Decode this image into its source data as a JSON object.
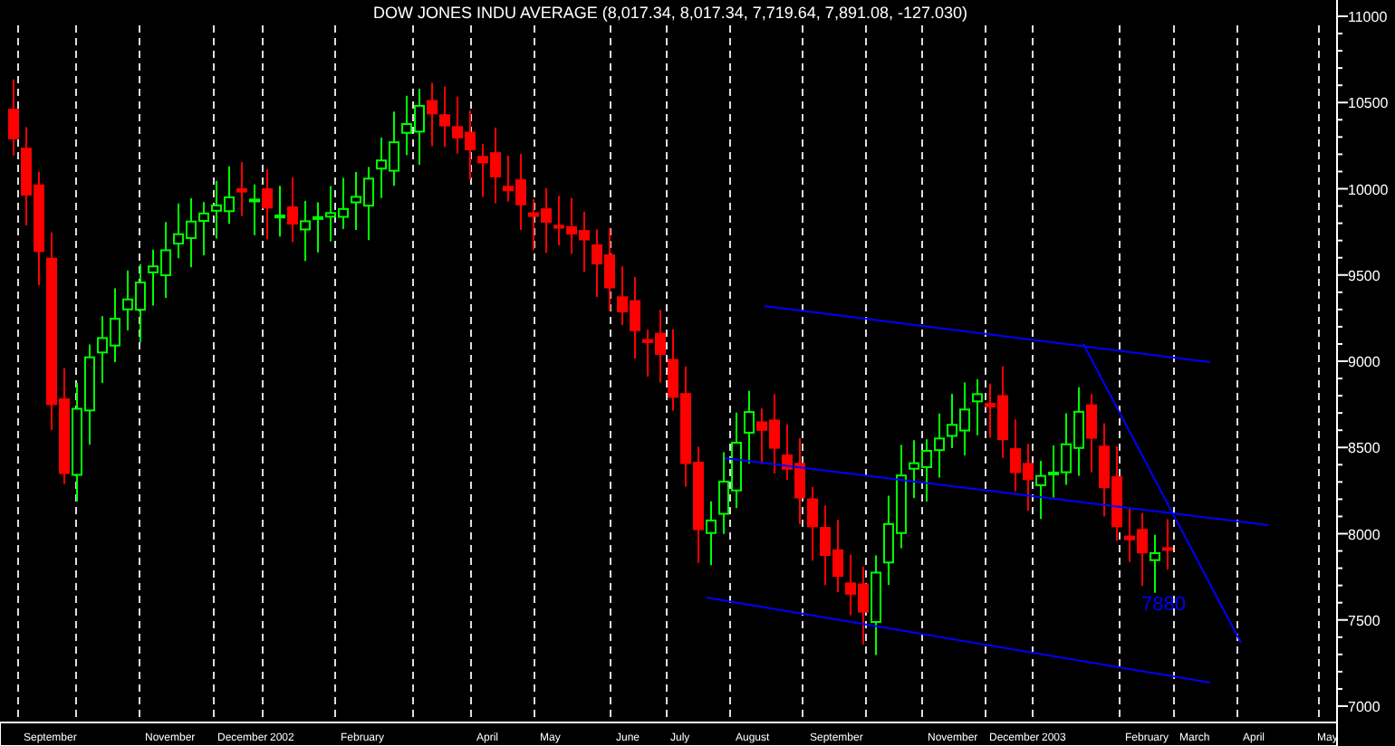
{
  "chart": {
    "title": "DOW JONES INDU AVERAGE (8,017.34, 8,017.34, 7,719.64, 7,891.08, -127.030)",
    "y_axis": [
      "11000",
      "10500",
      "10000",
      "9500",
      "9000",
      "8500",
      "8000",
      "7500",
      "7000"
    ],
    "x_axis": [
      "September",
      "November",
      "December",
      "2002",
      "February",
      "April",
      "May",
      "June",
      "July",
      "August",
      "September",
      "November",
      "December",
      "2003",
      "February",
      "March",
      "April",
      "May"
    ],
    "annotation": "7880"
  }
}
